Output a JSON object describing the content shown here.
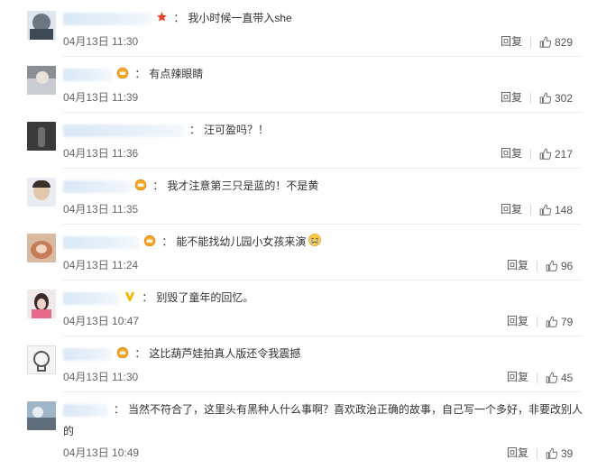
{
  "comments": [
    {
      "text": "我小时候一直带入she",
      "date": "04月13日",
      "time": "11:30",
      "reply": "回复",
      "likes": "829",
      "badge": "star"
    },
    {
      "text": "有点辣眼睛",
      "date": "04月13日",
      "time": "11:39",
      "reply": "回复",
      "likes": "302",
      "badge": "crown"
    },
    {
      "text": "汪可盈吗？！",
      "date": "04月13日",
      "time": "11:36",
      "reply": "回复",
      "likes": "217",
      "badge": "none"
    },
    {
      "text": "我才注意第三只是蓝的！不是黄",
      "date": "04月13日",
      "time": "11:35",
      "reply": "回复",
      "likes": "148",
      "badge": "crown"
    },
    {
      "text": "能不能找幼儿园小女孩来演",
      "date": "04月13日",
      "time": "11:24",
      "reply": "回复",
      "likes": "96",
      "badge": "crown"
    },
    {
      "text": "别毁了童年的回忆。",
      "date": "04月13日",
      "time": "10:47",
      "reply": "回复",
      "likes": "79",
      "badge": "v"
    },
    {
      "text": "这比葫芦娃拍真人版还令我震撼",
      "date": "04月13日",
      "time": "11:30",
      "reply": "回复",
      "likes": "45",
      "badge": "crown"
    },
    {
      "text_line1": "当然不符合了，这里头有黑种人什么事啊？喜欢政治正确的故事，自己写一个多好，非要改别人",
      "text_line2": "的",
      "date": "04月13日",
      "time": "10:49",
      "reply": "回复",
      "likes": "39",
      "badge": "none"
    }
  ],
  "colon": "：",
  "icons": {
    "like": "thumbs-up-icon",
    "star": "star-badge-icon",
    "crown": "crown-badge-icon",
    "v": "v-verified-icon",
    "emoji": "crying-face-icon"
  },
  "colors": {
    "text": "#333333",
    "meta": "#666666",
    "nick_blur": "#dbe9f7",
    "star": "#e8452c",
    "crown": "#f5a623",
    "v": "#f7b500"
  }
}
